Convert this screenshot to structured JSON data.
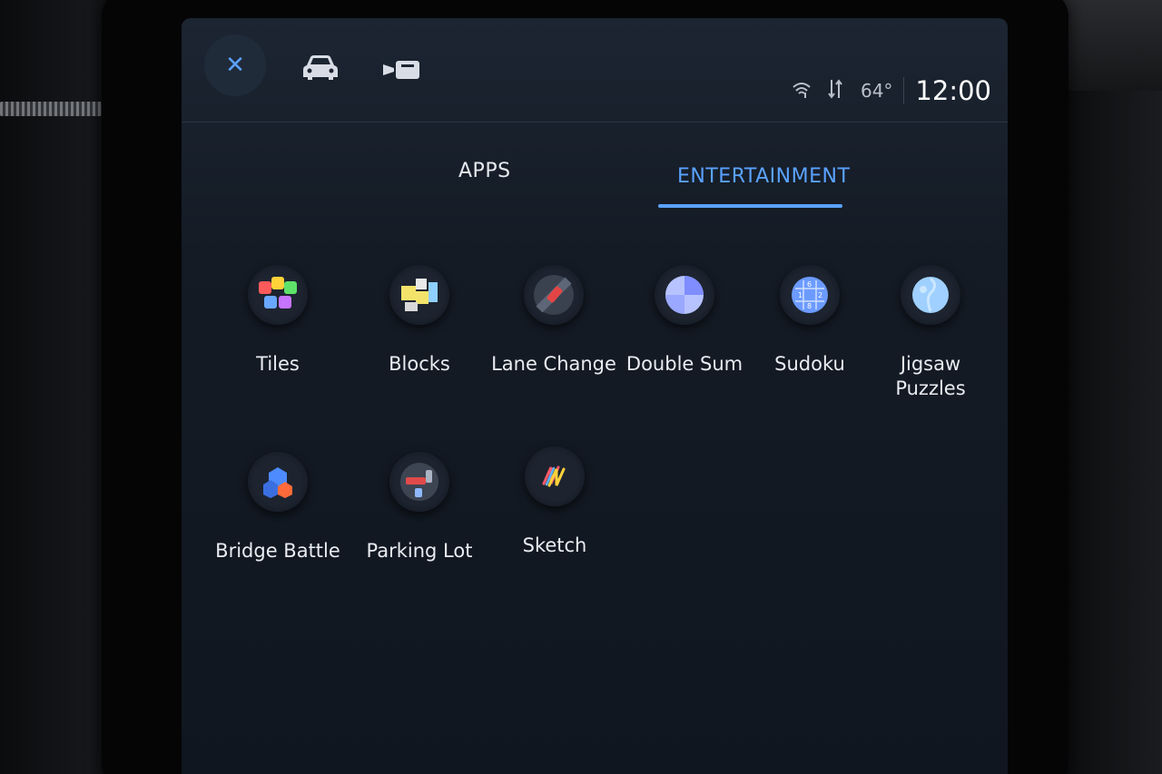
{
  "topbar": {
    "close_icon": "close-icon",
    "vehicle_icon": "car-icon",
    "camera_icon": "camera-icon",
    "status": {
      "wifi_icon": "wifi-icon",
      "signal_icon": "data-transfer-icon",
      "temperature": "64°",
      "time": "12:00"
    }
  },
  "tabs": [
    {
      "label": "APPS",
      "active": false
    },
    {
      "label": "ENTERTAINMENT",
      "active": true
    }
  ],
  "apps": [
    {
      "label": "Tiles",
      "icon": "tiles-icon"
    },
    {
      "label": "Blocks",
      "icon": "blocks-icon"
    },
    {
      "label": "Lane Change",
      "icon": "lane-change-icon"
    },
    {
      "label": "Double Sum",
      "icon": "double-sum-icon"
    },
    {
      "label": "Sudoku",
      "icon": "sudoku-icon"
    },
    {
      "label": "Jigsaw Puzzles",
      "icon": "jigsaw-icon"
    },
    {
      "label": "Bridge Battle",
      "icon": "bridge-battle-icon"
    },
    {
      "label": "Parking Lot",
      "icon": "parking-lot-icon"
    },
    {
      "label": "Sketch",
      "icon": "sketch-icon"
    }
  ],
  "colors": {
    "accent": "#5aa2ff",
    "screen_bg": "#141b25",
    "text": "#e9ecf1"
  }
}
